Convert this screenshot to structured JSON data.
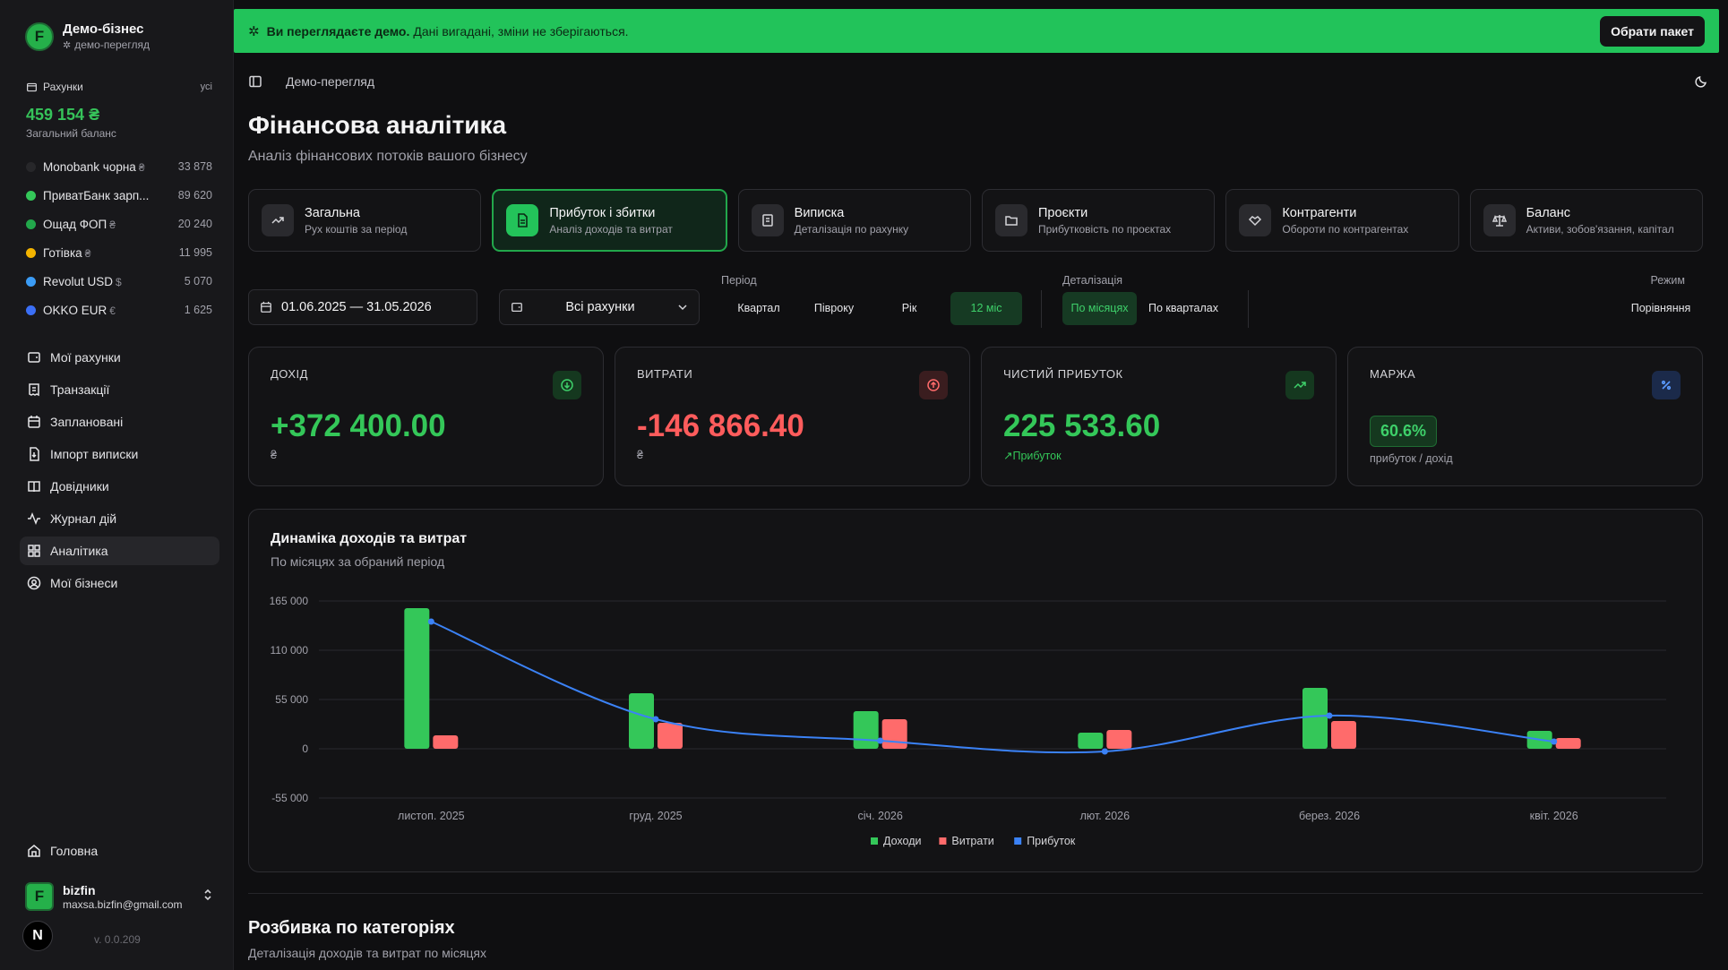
{
  "colors": {
    "accent": "#22c35a",
    "income": "#34c759",
    "expense": "#ff6b6b",
    "profit": "#3b82f6",
    "background": "#0f0f11"
  },
  "business": {
    "name": "Демо-бізнес",
    "mode": "демо-перегляд"
  },
  "accounts": {
    "title": "Рахунки",
    "all_link": "усі",
    "total": "459 154 ₴",
    "total_label": "Загальний баланс",
    "items": [
      {
        "name": "Monobank чорна",
        "currency": "₴",
        "amount": "33 878",
        "color": "#27272a"
      },
      {
        "name": "ПриватБанк зарп...",
        "currency": "",
        "amount": "89 620",
        "color": "#34c759"
      },
      {
        "name": "Ощад ФОП",
        "currency": "₴",
        "amount": "20 240",
        "color": "#22a74b"
      },
      {
        "name": "Готівка",
        "currency": "₴",
        "amount": "11 995",
        "color": "#f4b400"
      },
      {
        "name": "Revolut USD",
        "currency": "$",
        "amount": "5 070",
        "color": "#3b9cf6"
      },
      {
        "name": "OKKO EUR",
        "currency": "€",
        "amount": "1 625",
        "color": "#3b6ff6"
      }
    ]
  },
  "nav": {
    "items": [
      {
        "label": "Мої рахунки",
        "icon": "wallet-icon"
      },
      {
        "label": "Транзакції",
        "icon": "receipt-icon"
      },
      {
        "label": "Заплановані",
        "icon": "calendar-icon"
      },
      {
        "label": "Імпорт виписки",
        "icon": "file-import-icon"
      },
      {
        "label": "Довідники",
        "icon": "book-icon"
      },
      {
        "label": "Журнал дій",
        "icon": "activity-icon"
      },
      {
        "label": "Аналітика",
        "icon": "grid-icon"
      },
      {
        "label": "Мої бізнеси",
        "icon": "user-circle-icon"
      }
    ],
    "home": "Головна"
  },
  "user": {
    "name": "bizfin",
    "email": "maxsa.bizfin@gmail.com",
    "badge": "N",
    "version": "v. 0.0.209"
  },
  "banner": {
    "bold": "Ви переглядаєте демо.",
    "text": "Дані вигадані, зміни не зберігаються.",
    "button": "Обрати пакет"
  },
  "topbar": {
    "breadcrumb": "Демо-перегляд"
  },
  "page": {
    "title": "Фінансова аналітика",
    "subtitle": "Аналіз фінансових потоків вашого бізнесу"
  },
  "tabs": [
    {
      "title": "Загальна",
      "sub": "Рух коштів за період"
    },
    {
      "title": "Прибуток і збитки",
      "sub": "Аналіз доходів та витрат"
    },
    {
      "title": "Виписка",
      "sub": "Деталізація по рахунку"
    },
    {
      "title": "Проєкти",
      "sub": "Прибутковість по проєктах"
    },
    {
      "title": "Контрагенти",
      "sub": "Обороти по контрагентах"
    },
    {
      "title": "Баланс",
      "sub": "Активи, зобов'язання, капітал"
    }
  ],
  "filters": {
    "date_range": "01.06.2025 — 31.05.2026",
    "account": "Всі рахунки",
    "period_label": "Період",
    "periods": [
      "Квартал",
      "Півроку",
      "Рік",
      "12 міс"
    ],
    "detail_label": "Деталізація",
    "details": [
      "По місяцях",
      "По кварталах"
    ],
    "mode_label": "Режим",
    "mode": "Порівняння"
  },
  "kpis": [
    {
      "label": "ДОХІД",
      "value": "+372 400.00",
      "foot": "₴"
    },
    {
      "label": "ВИТРАТИ",
      "value": "-146 866.40",
      "foot": "₴"
    },
    {
      "label": "ЧИСТИЙ ПРИБУТОК",
      "value": "225 533.60",
      "foot": "Прибуток"
    },
    {
      "label": "МАРЖА",
      "value": "60.6%",
      "foot": "прибуток / дохід"
    }
  ],
  "chart": {
    "title": "Динаміка доходів та витрат",
    "subtitle": "По місяцях за обраний період"
  },
  "chart_data": {
    "type": "bar",
    "categories": [
      "листоп. 2025",
      "груд. 2025",
      "січ. 2026",
      "лют. 2026",
      "берез. 2026",
      "квіт. 2026"
    ],
    "series": [
      {
        "name": "Доходи",
        "type": "bar",
        "values": [
          157000,
          62000,
          42000,
          18000,
          68000,
          20000
        ]
      },
      {
        "name": "Витрати",
        "type": "bar",
        "values": [
          15000,
          29000,
          33000,
          21000,
          31000,
          12000
        ]
      },
      {
        "name": "Прибуток",
        "type": "line",
        "values": [
          142000,
          33000,
          9000,
          -3000,
          37000,
          8000
        ]
      }
    ],
    "yticks": [
      "165 000",
      "110 000",
      "55 000",
      "0",
      "-55 000"
    ],
    "ylim": [
      -55000,
      165000
    ],
    "grid": true,
    "legend": "bottom"
  },
  "breakdown": {
    "title": "Розбивка по категоріях",
    "subtitle": "Деталізація доходів та витрат по місяцях"
  }
}
